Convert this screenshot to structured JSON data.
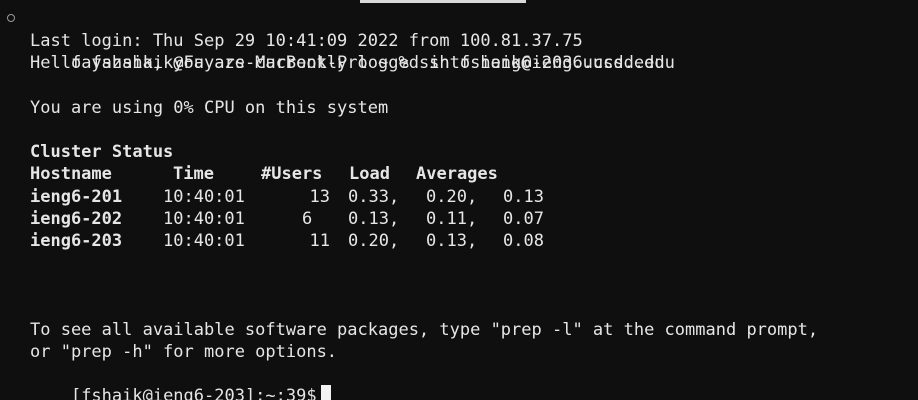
{
  "terminal": {
    "command_line": "fayazshaik@Fayazs-MacBook-Pro ~ % ssh fshaik@ieng6.ucsd.edu",
    "last_login": "Last login: Thu Sep 29 10:41:09 2022 from 100.81.37.75",
    "greeting": "Hello fshaik, you are currently logged into ieng6-203.ucsd.edu",
    "cpu_line": "You are using 0% CPU on this system",
    "cluster_title": "Cluster Status",
    "table": {
      "headers": [
        "Hostname",
        "Time",
        "#Users",
        "Load",
        "Averages"
      ],
      "rows": [
        {
          "host": "ieng6-201",
          "time": "10:40:01",
          "users": "13",
          "load1": "0.33,",
          "load2": "0.20,",
          "load3": "0.13"
        },
        {
          "host": "ieng6-202",
          "time": "10:40:01",
          "users": "6",
          "load1": "0.13,",
          "load2": "0.11,",
          "load3": "0.07"
        },
        {
          "host": "ieng6-203",
          "time": "10:40:01",
          "users": "11",
          "load1": "0.20,",
          "load2": "0.13,",
          "load3": "0.08"
        }
      ]
    },
    "footer_line1": "To see all available software packages, type \"prep -l\" at the command prompt,",
    "footer_line2": "or \"prep -h\" for more options.",
    "shell_prompt": "[fshaik@ieng6-203]:~:39$"
  }
}
